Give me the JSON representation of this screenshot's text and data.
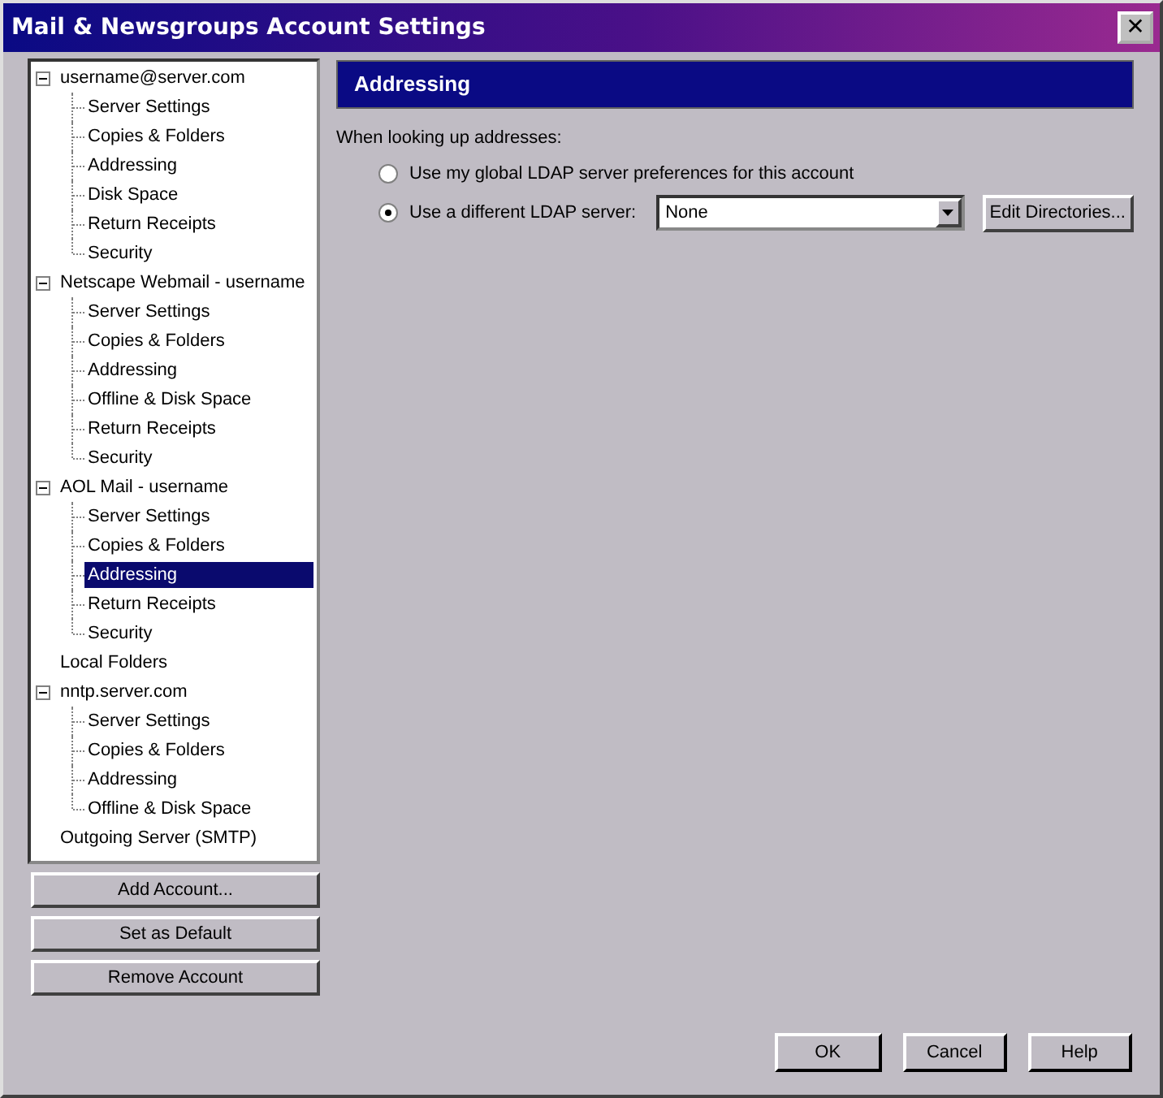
{
  "window": {
    "title": "Mail & Newsgroups Account Settings",
    "close": "✕"
  },
  "tree": [
    {
      "label": "username@server.com",
      "expanded": true,
      "selected": false,
      "children": [
        {
          "label": "Server Settings",
          "selected": false
        },
        {
          "label": "Copies & Folders",
          "selected": false
        },
        {
          "label": "Addressing",
          "selected": false
        },
        {
          "label": "Disk Space",
          "selected": false
        },
        {
          "label": "Return Receipts",
          "selected": false
        },
        {
          "label": "Security",
          "selected": false
        }
      ]
    },
    {
      "label": "Netscape Webmail - username",
      "expanded": true,
      "selected": false,
      "children": [
        {
          "label": "Server Settings",
          "selected": false
        },
        {
          "label": "Copies & Folders",
          "selected": false
        },
        {
          "label": "Addressing",
          "selected": false
        },
        {
          "label": "Offline & Disk Space",
          "selected": false
        },
        {
          "label": "Return Receipts",
          "selected": false
        },
        {
          "label": "Security",
          "selected": false
        }
      ]
    },
    {
      "label": "AOL Mail - username",
      "expanded": true,
      "selected": false,
      "children": [
        {
          "label": "Server Settings",
          "selected": false
        },
        {
          "label": "Copies & Folders",
          "selected": false
        },
        {
          "label": "Addressing",
          "selected": true
        },
        {
          "label": "Return Receipts",
          "selected": false
        },
        {
          "label": "Security",
          "selected": false
        }
      ]
    },
    {
      "label": "Local Folders",
      "selected": false
    },
    {
      "label": "nntp.server.com",
      "expanded": true,
      "selected": false,
      "children": [
        {
          "label": "Server Settings",
          "selected": false
        },
        {
          "label": "Copies & Folders",
          "selected": false
        },
        {
          "label": "Addressing",
          "selected": false
        },
        {
          "label": "Offline & Disk Space",
          "selected": false
        }
      ]
    },
    {
      "label": "Outgoing Server (SMTP)",
      "selected": false
    }
  ],
  "account_buttons": [
    "Add Account...",
    "Set as Default",
    "Remove Account"
  ],
  "panel": {
    "header": "Addressing",
    "prompt": "When looking up addresses:",
    "options": [
      {
        "label": "Use my global LDAP server preferences for this account",
        "selected": false
      },
      {
        "label": "Use a different LDAP server:",
        "selected": true
      }
    ],
    "server_dropdown": {
      "value": "None"
    },
    "edit_button": "Edit Directories..."
  },
  "buttons": [
    "OK",
    "Cancel",
    "Help"
  ]
}
